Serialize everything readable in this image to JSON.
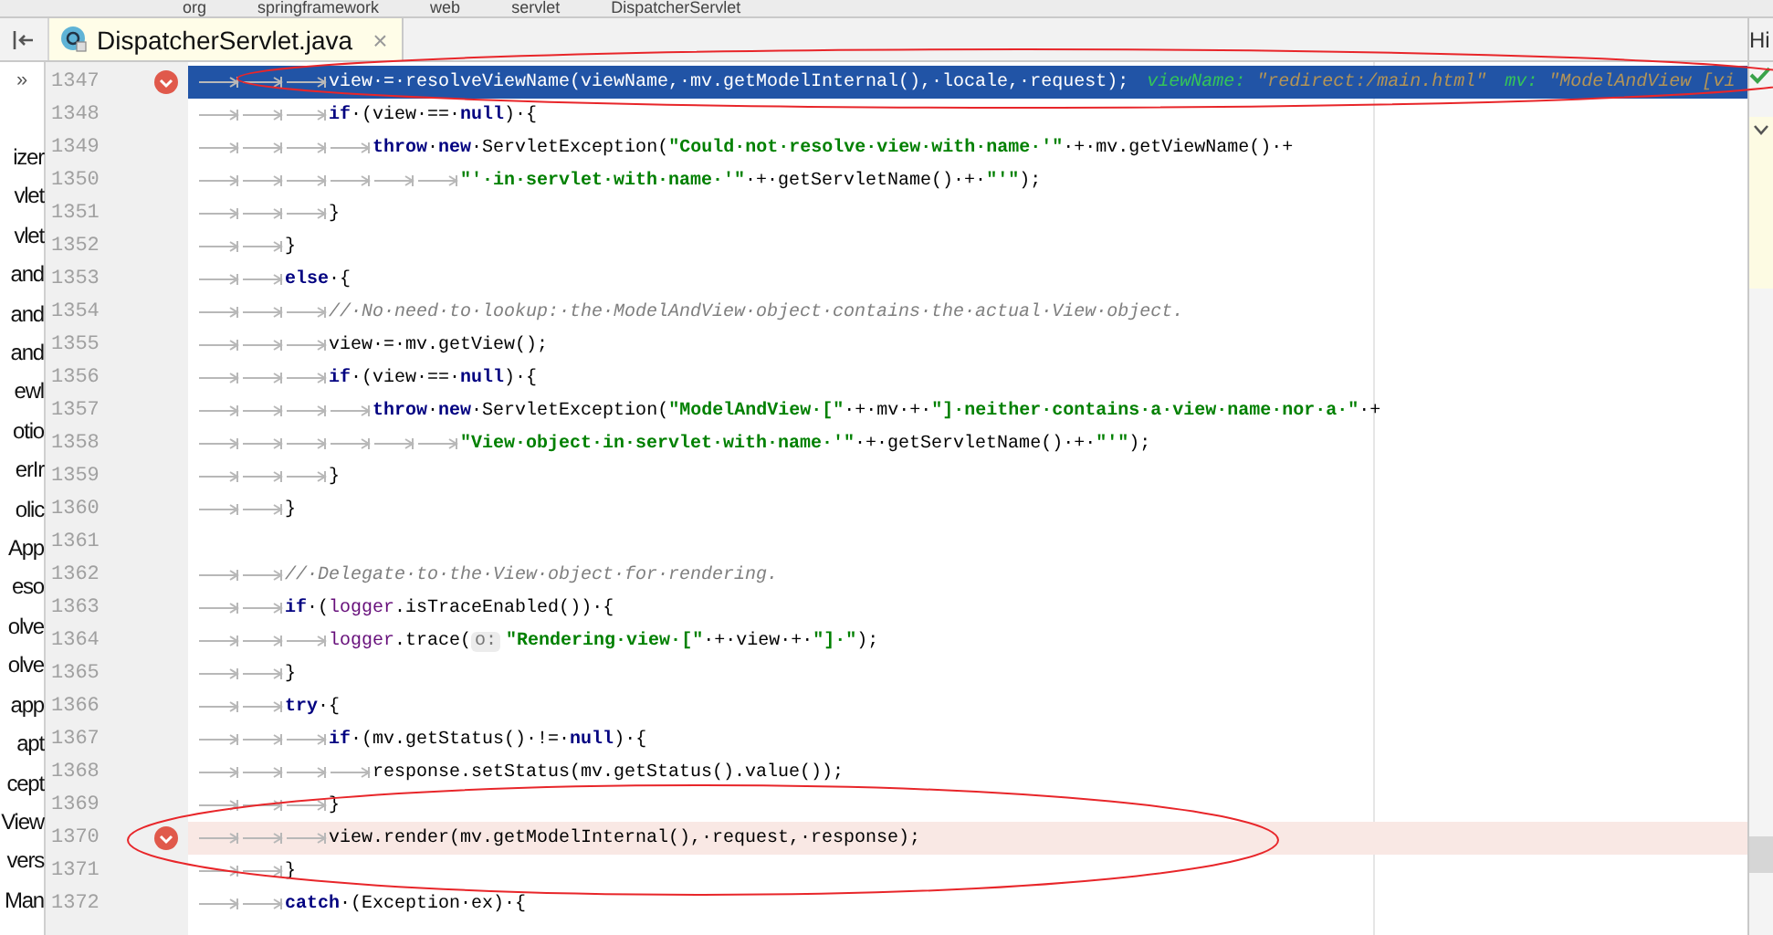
{
  "breadcrumb": [
    "org",
    "springframework",
    "web",
    "servlet",
    "DispatcherServlet"
  ],
  "editor_tab": {
    "label": "DispatcherServlet.java",
    "selected": true,
    "close": "×"
  },
  "project_panel": {
    "expand": "»",
    "items": [
      "izer",
      "vlet",
      "vlet",
      "and",
      "and",
      "and",
      "ewl",
      "otio",
      "erIr",
      "olic",
      "App",
      "eso",
      "olve",
      "olve",
      "app",
      "apt",
      "cept",
      "View",
      "vers",
      "Man"
    ]
  },
  "right_panel": {
    "title": "Hi"
  },
  "lines": [
    {
      "number": "1347",
      "breakpoint": true,
      "execution_point": true,
      "segments": [
        {
          "kind": "tab"
        },
        {
          "kind": "tab"
        },
        {
          "kind": "tab"
        },
        {
          "kind": "plain",
          "text": "view·=·resolveViewName(viewName,·mv.getModelInternal(),·locale,·request);"
        }
      ],
      "hints": [
        {
          "name": "viewName:",
          "value": "\"redirect:/main.html\""
        },
        {
          "name": "mv:",
          "value": "\"ModelAndView [vi"
        }
      ]
    },
    {
      "number": "1348",
      "breakpoint": false,
      "execution_point": false,
      "segments": [
        {
          "kind": "tab"
        },
        {
          "kind": "tab"
        },
        {
          "kind": "tab"
        },
        {
          "kind": "keyword",
          "text": "if"
        },
        {
          "kind": "plain",
          "text": "·(view·==·"
        },
        {
          "kind": "keyword",
          "text": "null"
        },
        {
          "kind": "plain",
          "text": ")·{"
        }
      ]
    },
    {
      "number": "1349",
      "breakpoint": false,
      "execution_point": false,
      "segments": [
        {
          "kind": "tab"
        },
        {
          "kind": "tab"
        },
        {
          "kind": "tab"
        },
        {
          "kind": "tab"
        },
        {
          "kind": "keyword",
          "text": "throw"
        },
        {
          "kind": "plain",
          "text": "·"
        },
        {
          "kind": "keyword",
          "text": "new"
        },
        {
          "kind": "plain",
          "text": "·ServletException("
        },
        {
          "kind": "string",
          "text": "\"Could·not·resolve·view·with·name·'\""
        },
        {
          "kind": "plain",
          "text": "·+·mv.getViewName()·+"
        }
      ]
    },
    {
      "number": "1350",
      "breakpoint": false,
      "execution_point": false,
      "segments": [
        {
          "kind": "tab"
        },
        {
          "kind": "tab"
        },
        {
          "kind": "tab"
        },
        {
          "kind": "tab"
        },
        {
          "kind": "tab"
        },
        {
          "kind": "tab"
        },
        {
          "kind": "string",
          "text": "\"'·in·servlet·with·name·'\""
        },
        {
          "kind": "plain",
          "text": "·+·getServletName()·+·"
        },
        {
          "kind": "string",
          "text": "\"'\""
        },
        {
          "kind": "plain",
          "text": ");"
        }
      ]
    },
    {
      "number": "1351",
      "breakpoint": false,
      "execution_point": false,
      "segments": [
        {
          "kind": "tab"
        },
        {
          "kind": "tab"
        },
        {
          "kind": "tab"
        },
        {
          "kind": "plain",
          "text": "}"
        }
      ]
    },
    {
      "number": "1352",
      "breakpoint": false,
      "execution_point": false,
      "segments": [
        {
          "kind": "tab"
        },
        {
          "kind": "tab"
        },
        {
          "kind": "plain",
          "text": "}"
        }
      ]
    },
    {
      "number": "1353",
      "breakpoint": false,
      "execution_point": false,
      "segments": [
        {
          "kind": "tab"
        },
        {
          "kind": "tab"
        },
        {
          "kind": "keyword",
          "text": "else"
        },
        {
          "kind": "plain",
          "text": "·{"
        }
      ]
    },
    {
      "number": "1354",
      "breakpoint": false,
      "execution_point": false,
      "segments": [
        {
          "kind": "tab"
        },
        {
          "kind": "tab"
        },
        {
          "kind": "tab"
        },
        {
          "kind": "comment",
          "text": "//·No·need·to·lookup:·the·ModelAndView·object·contains·the·actual·View·object."
        }
      ]
    },
    {
      "number": "1355",
      "breakpoint": false,
      "execution_point": false,
      "segments": [
        {
          "kind": "tab"
        },
        {
          "kind": "tab"
        },
        {
          "kind": "tab"
        },
        {
          "kind": "plain",
          "text": "view·=·mv.getView();"
        }
      ]
    },
    {
      "number": "1356",
      "breakpoint": false,
      "execution_point": false,
      "segments": [
        {
          "kind": "tab"
        },
        {
          "kind": "tab"
        },
        {
          "kind": "tab"
        },
        {
          "kind": "keyword",
          "text": "if"
        },
        {
          "kind": "plain",
          "text": "·(view·==·"
        },
        {
          "kind": "keyword",
          "text": "null"
        },
        {
          "kind": "plain",
          "text": ")·{"
        }
      ]
    },
    {
      "number": "1357",
      "breakpoint": false,
      "execution_point": false,
      "segments": [
        {
          "kind": "tab"
        },
        {
          "kind": "tab"
        },
        {
          "kind": "tab"
        },
        {
          "kind": "tab"
        },
        {
          "kind": "keyword",
          "text": "throw"
        },
        {
          "kind": "plain",
          "text": "·"
        },
        {
          "kind": "keyword",
          "text": "new"
        },
        {
          "kind": "plain",
          "text": "·ServletException("
        },
        {
          "kind": "string",
          "text": "\"ModelAndView·[\""
        },
        {
          "kind": "plain",
          "text": "·+·mv·+·"
        },
        {
          "kind": "string",
          "text": "\"]·neither·contains·a·view·name·nor·a·\""
        },
        {
          "kind": "plain",
          "text": "·+"
        }
      ]
    },
    {
      "number": "1358",
      "breakpoint": false,
      "execution_point": false,
      "segments": [
        {
          "kind": "tab"
        },
        {
          "kind": "tab"
        },
        {
          "kind": "tab"
        },
        {
          "kind": "tab"
        },
        {
          "kind": "tab"
        },
        {
          "kind": "tab"
        },
        {
          "kind": "string",
          "text": "\"View·object·in·servlet·with·name·'\""
        },
        {
          "kind": "plain",
          "text": "·+·getServletName()·+·"
        },
        {
          "kind": "string",
          "text": "\"'\""
        },
        {
          "kind": "plain",
          "text": ");"
        }
      ]
    },
    {
      "number": "1359",
      "breakpoint": false,
      "execution_point": false,
      "segments": [
        {
          "kind": "tab"
        },
        {
          "kind": "tab"
        },
        {
          "kind": "tab"
        },
        {
          "kind": "plain",
          "text": "}"
        }
      ]
    },
    {
      "number": "1360",
      "breakpoint": false,
      "execution_point": false,
      "segments": [
        {
          "kind": "tab"
        },
        {
          "kind": "tab"
        },
        {
          "kind": "plain",
          "text": "}"
        }
      ]
    },
    {
      "number": "1361",
      "breakpoint": false,
      "execution_point": false
    },
    {
      "number": "1362",
      "breakpoint": false,
      "execution_point": false,
      "segments": [
        {
          "kind": "tab"
        },
        {
          "kind": "tab"
        },
        {
          "kind": "comment",
          "text": "//·Delegate·to·the·View·object·for·rendering."
        }
      ]
    },
    {
      "number": "1363",
      "breakpoint": false,
      "execution_point": false,
      "segments": [
        {
          "kind": "tab"
        },
        {
          "kind": "tab"
        },
        {
          "kind": "keyword",
          "text": "if"
        },
        {
          "kind": "plain",
          "text": "·("
        },
        {
          "kind": "field",
          "text": "logger"
        },
        {
          "kind": "plain",
          "text": ".isTraceEnabled())·{"
        }
      ]
    },
    {
      "number": "1364",
      "breakpoint": false,
      "execution_point": false,
      "segments": [
        {
          "kind": "tab"
        },
        {
          "kind": "tab"
        },
        {
          "kind": "tab"
        },
        {
          "kind": "field",
          "text": "logger"
        },
        {
          "kind": "plain",
          "text": ".trace("
        },
        {
          "kind": "param",
          "text": "o:"
        },
        {
          "kind": "string",
          "text": "\"Rendering·view·[\""
        },
        {
          "kind": "plain",
          "text": "·+·view·+·"
        },
        {
          "kind": "string",
          "text": "\"]·\""
        },
        {
          "kind": "plain",
          "text": ");"
        }
      ]
    },
    {
      "number": "1365",
      "breakpoint": false,
      "execution_point": false,
      "segments": [
        {
          "kind": "tab"
        },
        {
          "kind": "tab"
        },
        {
          "kind": "plain",
          "text": "}"
        }
      ]
    },
    {
      "number": "1366",
      "breakpoint": false,
      "execution_point": false,
      "segments": [
        {
          "kind": "tab"
        },
        {
          "kind": "tab"
        },
        {
          "kind": "keyword",
          "text": "try"
        },
        {
          "kind": "plain",
          "text": "·{"
        }
      ]
    },
    {
      "number": "1367",
      "breakpoint": false,
      "execution_point": false,
      "segments": [
        {
          "kind": "tab"
        },
        {
          "kind": "tab"
        },
        {
          "kind": "tab"
        },
        {
          "kind": "keyword",
          "text": "if"
        },
        {
          "kind": "plain",
          "text": "·(mv.getStatus()·!=·"
        },
        {
          "kind": "keyword",
          "text": "null"
        },
        {
          "kind": "plain",
          "text": ")·{"
        }
      ]
    },
    {
      "number": "1368",
      "breakpoint": false,
      "execution_point": false,
      "segments": [
        {
          "kind": "tab"
        },
        {
          "kind": "tab"
        },
        {
          "kind": "tab"
        },
        {
          "kind": "tab"
        },
        {
          "kind": "plain",
          "text": "response.setStatus(mv.getStatus().value());"
        }
      ]
    },
    {
      "number": "1369",
      "breakpoint": false,
      "execution_point": false,
      "segments": [
        {
          "kind": "tab"
        },
        {
          "kind": "tab"
        },
        {
          "kind": "tab"
        },
        {
          "kind": "plain",
          "text": "}"
        }
      ]
    },
    {
      "number": "1370",
      "breakpoint": true,
      "execution_point": false,
      "segments": [
        {
          "kind": "tab"
        },
        {
          "kind": "tab"
        },
        {
          "kind": "tab"
        },
        {
          "kind": "plain",
          "text": "view.render(mv.getModelInternal(),·request,·response);"
        }
      ]
    },
    {
      "number": "1371",
      "breakpoint": false,
      "execution_point": false,
      "segments": [
        {
          "kind": "tab"
        },
        {
          "kind": "tab"
        },
        {
          "kind": "plain",
          "text": "}"
        }
      ]
    },
    {
      "number": "1372",
      "breakpoint": false,
      "execution_point": false,
      "segments": [
        {
          "kind": "tab"
        },
        {
          "kind": "tab"
        },
        {
          "kind": "keyword",
          "text": "catch"
        },
        {
          "kind": "plain",
          "text": "·(Exception·ex)·{"
        }
      ]
    }
  ]
}
